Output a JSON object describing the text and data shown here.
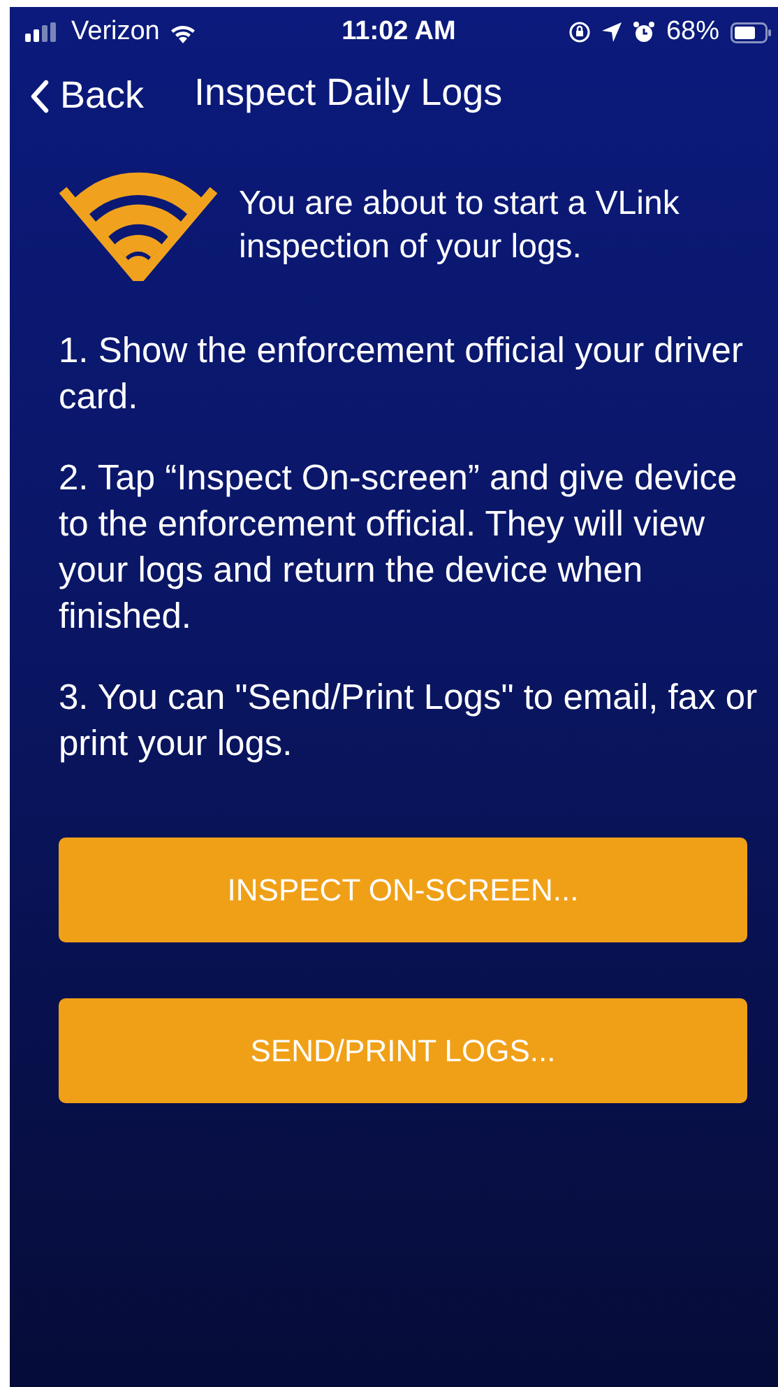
{
  "status_bar": {
    "carrier": "Verizon",
    "time": "11:02 AM",
    "battery": "68%"
  },
  "nav": {
    "back": "Back",
    "title": "Inspect Daily Logs"
  },
  "intro": "You are about to start a VLink inspection of your logs.",
  "steps": [
    "1. Show the enforcement official your driver card.",
    "2. Tap “Inspect On-screen” and give device to the enforcement official. They will view your logs and return the device when finished.",
    "3. You can \"Send/Print Logs\" to email, fax or print your logs."
  ],
  "buttons": [
    "INSPECT ON-SCREEN...",
    "SEND/PRINT LOGS..."
  ]
}
